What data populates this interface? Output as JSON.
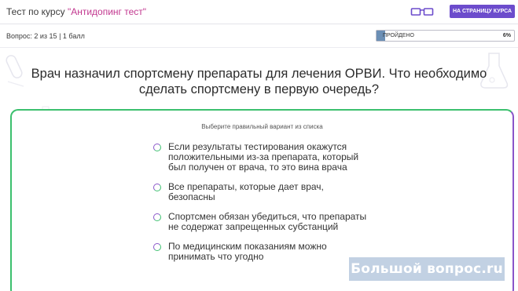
{
  "header": {
    "title_prefix": "Тест по курсу ",
    "course_name": "\"Антидопинг тест\"",
    "to_course_label": "НА СТРАНИЦУ КУРСА",
    "glasses_icon": "glasses-icon"
  },
  "status": {
    "question_info": "Вопрос: 2 из 15 | 1 балл",
    "progress_label": "ПРОЙДЕНО",
    "progress_percent_text": "6%",
    "progress_fraction": 0.06
  },
  "question": {
    "text": "Врач назначил спортсмену препараты для лечения ОРВИ. Что необходимо сделать спортсмену в первую очередь?"
  },
  "answers": {
    "instruction": "Выберите правильный вариант из списка",
    "options": [
      {
        "label": "Если результаты тестирования окажутся положительными из-за препарата, который был получен от врача, то это вина врача"
      },
      {
        "label": "Все препараты, которые дает врач, безопасны"
      },
      {
        "label": "Спортсмен обязан убедиться, что препараты не содержат запрещенных субстанций"
      },
      {
        "label": "По медицинским показаниям можно принимать что угодно"
      }
    ]
  },
  "watermark": {
    "text": "Большой вопрос.ru"
  },
  "colors": {
    "accent_purple": "#6c4ccc",
    "course_pink": "#c2378f",
    "border_green": "#3cc06e",
    "border_violet": "#8a55c9",
    "progress_fill": "#6b8fb5"
  }
}
